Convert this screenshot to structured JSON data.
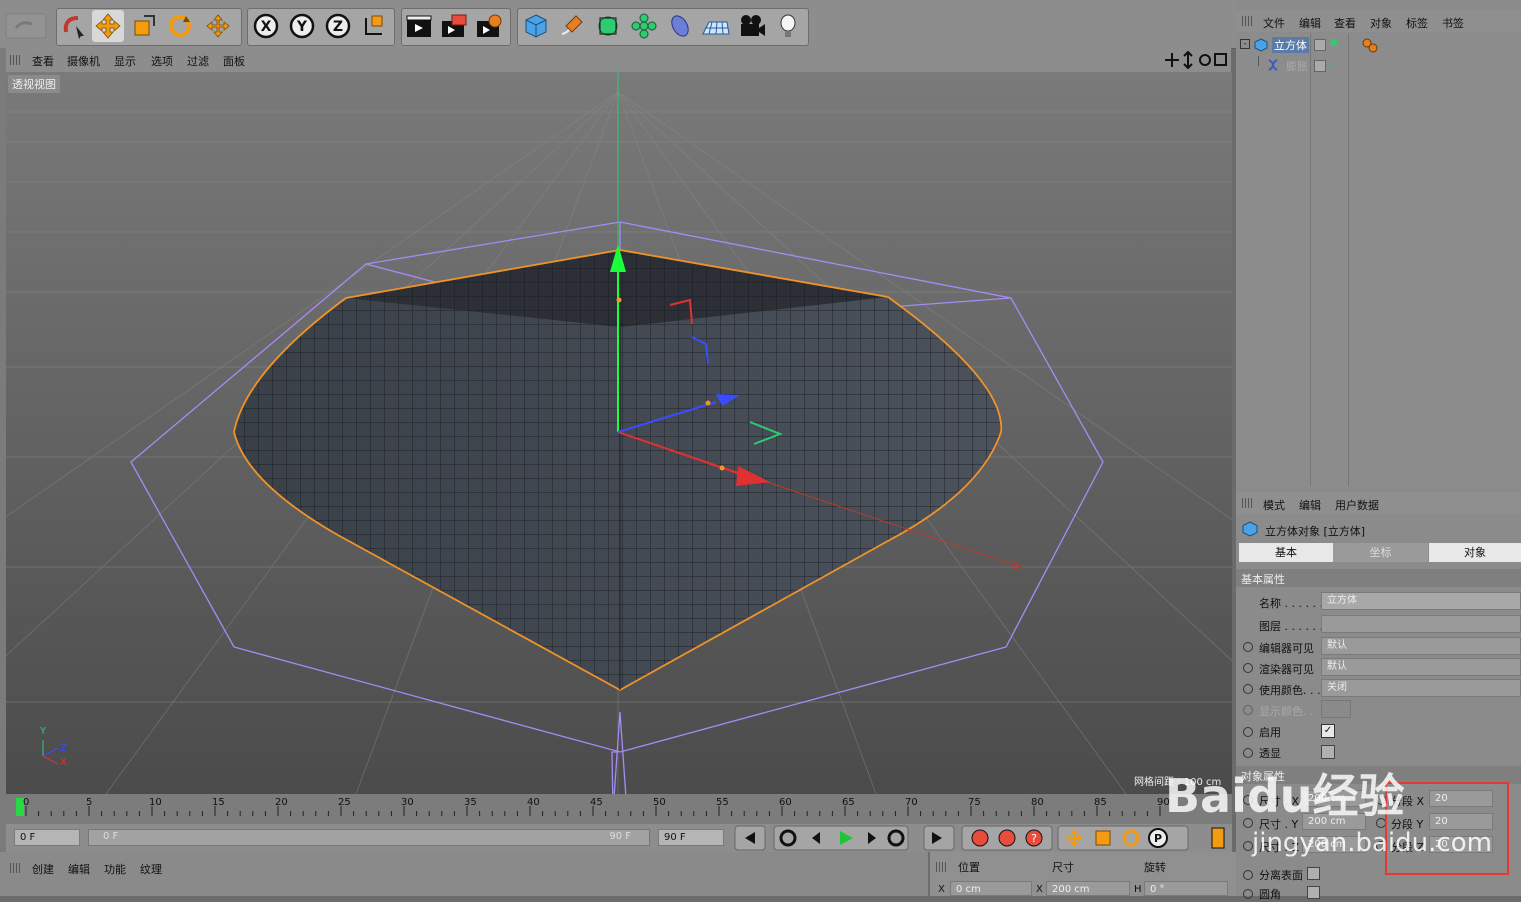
{
  "viewport": {
    "menu": [
      "查看",
      "摄像机",
      "显示",
      "选项",
      "过滤",
      "面板"
    ],
    "title": "透视视图",
    "grid_spacing": "网格间距 : 100 cm",
    "axis_labels": {
      "y": "Y",
      "z": "Z",
      "x": "X"
    }
  },
  "timeline": {
    "ticks": [
      "0",
      "5",
      "10",
      "15",
      "20",
      "25",
      "30",
      "35",
      "40",
      "45",
      "50",
      "55",
      "60",
      "65",
      "70",
      "75",
      "80",
      "85",
      "90"
    ]
  },
  "transport": {
    "current_frame": "0 F",
    "range_start": "0 F",
    "range_end": "90 F",
    "end_frame": "90 F"
  },
  "bottom": {
    "menu": [
      "创建",
      "编辑",
      "功能",
      "纹理"
    ],
    "coord_headers": [
      "位置",
      "尺寸",
      "旋转"
    ],
    "coord_values": {
      "x_pos": "0 cm",
      "x_size": "200 cm",
      "h_rot": "0 °"
    },
    "coord_axes": {
      "x": "X",
      "x2": "X",
      "h": "H"
    }
  },
  "object_manager": {
    "menu": [
      "文件",
      "编辑",
      "查看",
      "对象",
      "标签",
      "书签"
    ],
    "objects": [
      {
        "name": "立方体",
        "selected": true
      },
      {
        "name": "膨胀",
        "selected": false
      }
    ]
  },
  "attributes": {
    "menu": [
      "模式",
      "编辑",
      "用户数据"
    ],
    "header": "立方体对象 [立方体]",
    "tabs": [
      "基本",
      "坐标",
      "对象"
    ],
    "section_basic": "基本属性",
    "basic_rows": [
      {
        "label": "名称 . . . . . .",
        "value": "立方体"
      },
      {
        "label": "图层 . . . . . .",
        "value": ""
      },
      {
        "label": "编辑器可见",
        "value": "默认"
      },
      {
        "label": "渲染器可见",
        "value": "默认"
      },
      {
        "label": "使用颜色. . .",
        "value": "关闭"
      },
      {
        "label": "显示颜色. .",
        "value": ""
      },
      {
        "label": "启用",
        "value": ""
      },
      {
        "label": "透显",
        "value": ""
      }
    ],
    "section_object": "对象属性",
    "size_labels": [
      "尺寸 . X",
      "尺寸 . Y",
      "尺寸 . Z"
    ],
    "size_values": [
      "200 cm",
      "200 cm",
      "200 cm"
    ],
    "seg_labels": [
      "分段 X",
      "分段 Y",
      "分段 Z"
    ],
    "seg_values": [
      "20",
      "20",
      "20"
    ],
    "bottom_rows": [
      "分离表面",
      "圆角"
    ]
  },
  "watermark": {
    "text": "Baidu经验",
    "url": "jingyan.baidu.com"
  },
  "colors": {
    "selection": "#f0932b",
    "bbox": "#a58cf5",
    "highlight_box": "#e53935"
  }
}
